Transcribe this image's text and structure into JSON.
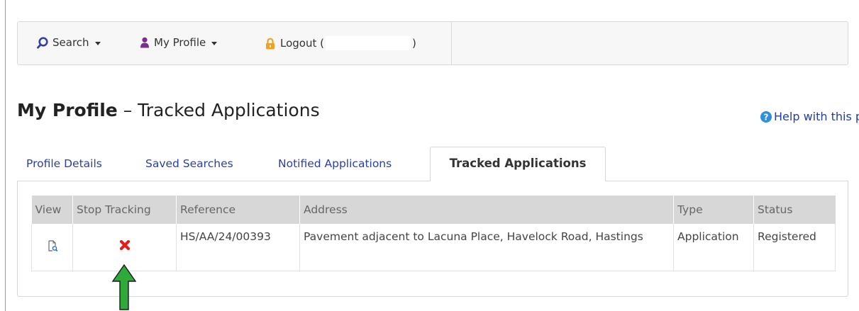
{
  "nav": {
    "search_label": "Search",
    "profile_label": "My Profile",
    "logout_prefix": "Logout (",
    "logout_suffix": ")"
  },
  "page": {
    "title_strong": "My Profile",
    "title_rest": " – Tracked Applications",
    "help_label": "Help with this page"
  },
  "tabs": [
    {
      "label": "Profile Details"
    },
    {
      "label": "Saved Searches"
    },
    {
      "label": "Notified Applications"
    },
    {
      "label": "Tracked Applications",
      "active": true
    }
  ],
  "table": {
    "headers": [
      "View",
      "Stop Tracking",
      "Reference",
      "Address",
      "Type",
      "Status"
    ],
    "rows": [
      {
        "reference": "HS/AA/24/00393",
        "address": "Pavement adjacent to Lacuna Place, Havelock Road, Hastings",
        "type": "Application",
        "status": "Registered"
      }
    ]
  },
  "icons": {
    "search": "search-icon",
    "profile": "user-icon",
    "logout": "lock-icon",
    "help": "question-circle-icon",
    "view": "view-document-icon",
    "stop": "remove-x-icon",
    "annotation": "green-up-arrow"
  },
  "colors": {
    "link": "#2a3fa7",
    "stop_icon": "#e02020",
    "annotation_arrow": "#2eaa3a",
    "header_bg": "#d7d7d7"
  }
}
